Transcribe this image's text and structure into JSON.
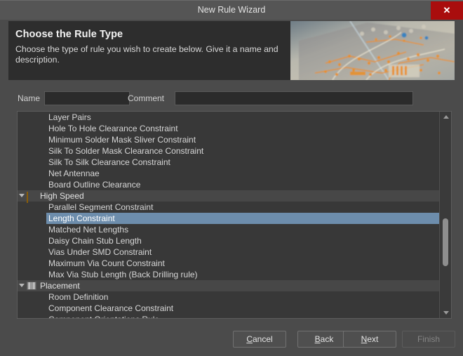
{
  "window": {
    "title": "New Rule Wizard",
    "close_label": "✕",
    "close_color": "#a90d0d"
  },
  "header": {
    "title": "Choose the Rule Type",
    "description": "Choose the type of rule you wish to create below. Give it a name and description.",
    "art": "pcb-board-photo"
  },
  "fields": {
    "name_label": "Name",
    "name_value": "",
    "name_placeholder": "",
    "comment_label": "Comment",
    "comment_value": "",
    "comment_placeholder": ""
  },
  "rule_tree": {
    "selected": "Length Constraint",
    "selection_color": "#6d8dac",
    "rows": [
      {
        "type": "leaf",
        "label": "Layer Pairs"
      },
      {
        "type": "leaf",
        "label": "Hole To Hole Clearance Constraint"
      },
      {
        "type": "leaf",
        "label": "Minimum Solder Mask Sliver Constraint"
      },
      {
        "type": "leaf",
        "label": "Silk To Solder Mask Clearance Constraint"
      },
      {
        "type": "leaf",
        "label": "Silk To Silk Clearance Constraint"
      },
      {
        "type": "leaf",
        "label": "Net Antennae"
      },
      {
        "type": "leaf",
        "label": "Board Outline Clearance"
      },
      {
        "type": "group",
        "label": "High Speed",
        "icon": "high-speed-icon",
        "expanded": true
      },
      {
        "type": "leaf",
        "label": "Parallel Segment Constraint"
      },
      {
        "type": "leaf",
        "label": "Length Constraint",
        "selected": true
      },
      {
        "type": "leaf",
        "label": "Matched Net Lengths"
      },
      {
        "type": "leaf",
        "label": "Daisy Chain Stub Length"
      },
      {
        "type": "leaf",
        "label": "Vias Under SMD Constraint"
      },
      {
        "type": "leaf",
        "label": "Maximum Via Count Constraint"
      },
      {
        "type": "leaf",
        "label": "Max Via Stub Length (Back Drilling rule)"
      },
      {
        "type": "group",
        "label": "Placement",
        "icon": "placement-icon",
        "expanded": true
      },
      {
        "type": "leaf",
        "label": "Room Definition"
      },
      {
        "type": "leaf",
        "label": "Component Clearance Constraint"
      },
      {
        "type": "leaf",
        "label": "Component Orientations Rule",
        "clipped": true
      }
    ]
  },
  "scrollbar": {
    "up_arrow": "scroll-up",
    "down_arrow": "scroll-down"
  },
  "footer": {
    "buttons": [
      {
        "id": "cancel",
        "label": "Cancel",
        "accel": "C",
        "enabled": true
      },
      {
        "id": "back",
        "label": "Back",
        "accel": "B",
        "enabled": true
      },
      {
        "id": "next",
        "label": "Next",
        "accel": "N",
        "enabled": true
      },
      {
        "id": "finish",
        "label": "Finish",
        "accel": "",
        "enabled": false
      }
    ]
  }
}
